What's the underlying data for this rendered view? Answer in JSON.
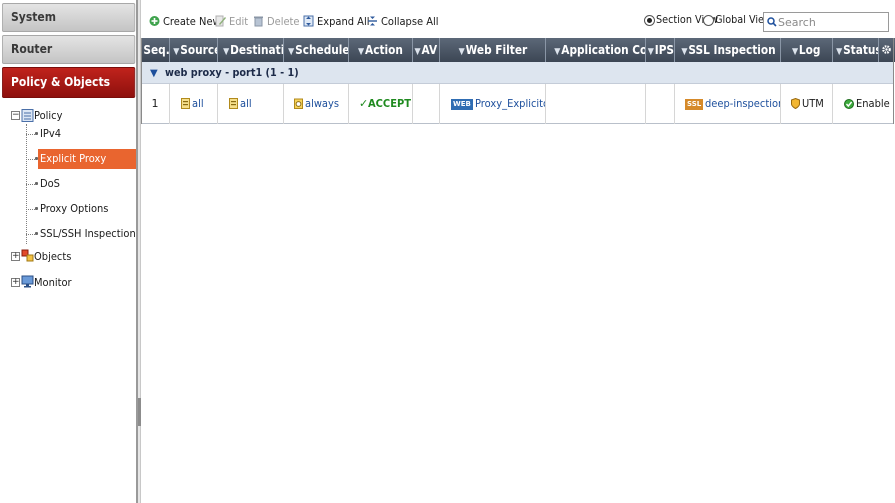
{
  "sidebar": {
    "sections": [
      {
        "label": "System"
      },
      {
        "label": "Router"
      },
      {
        "label": "Policy & Objects"
      }
    ],
    "tree": {
      "policy": "Policy",
      "ipv4": "IPv4",
      "explicit_proxy": "Explicit Proxy",
      "dos": "DoS",
      "proxy_options": "Proxy Options",
      "ssl_ssh_inspection": "SSL/SSH Inspection",
      "objects": "Objects",
      "monitor": "Monitor"
    }
  },
  "toolbar": {
    "create_new": "Create New",
    "edit": "Edit",
    "delete": "Delete",
    "expand_all": "Expand All",
    "collapse_all": "Collapse All",
    "section_view": "Section View",
    "global_view": "Global View",
    "view_selected": "Section View",
    "search_placeholder": "Search"
  },
  "grid": {
    "columns": [
      "Seq.#",
      "Source",
      "Destination",
      "Schedule",
      "Action",
      "AV",
      "Web Filter",
      "Application Control",
      "IPS",
      "SSL Inspection",
      "Log",
      "Status"
    ],
    "section_label": "web proxy - port1 (1 - 1)",
    "rows": [
      {
        "seq": "1",
        "source": "all",
        "destination": "all",
        "schedule": "always",
        "action": "ACCEPT",
        "av": "",
        "web_filter_badge": "WEB",
        "web_filter": "Proxy_Explicito",
        "application_control": "",
        "ips": "",
        "ssl_badge": "SSL",
        "ssl_inspection": "deep-inspection",
        "log": "UTM",
        "status": "Enable"
      }
    ]
  },
  "colors": {
    "active_section": "#b01a14",
    "selected_item": "#e9652f",
    "grid_header": "#4a5566",
    "section_row": "#dde5ef",
    "accept": "#1f8a1f",
    "link": "#1d4f9c"
  }
}
